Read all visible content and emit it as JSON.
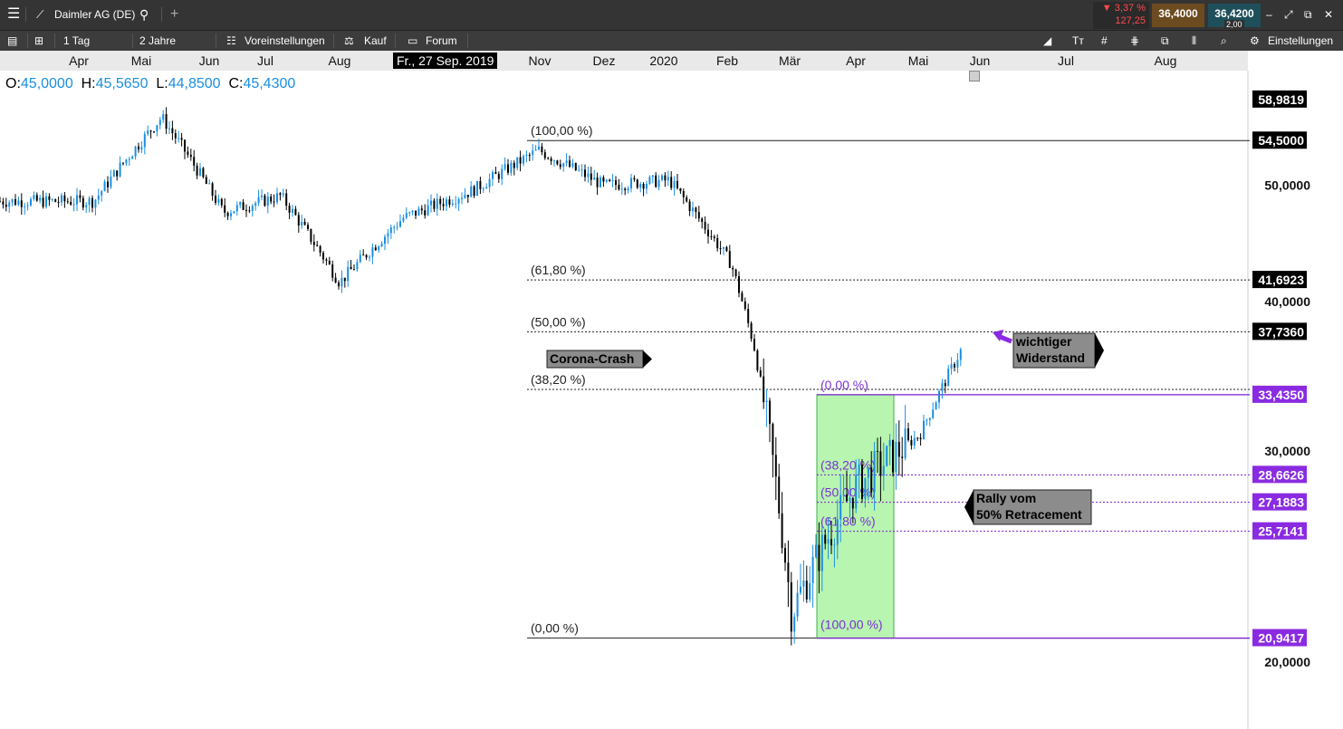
{
  "header": {
    "instrument": "Daimler AG (DE)",
    "change_pct": "▼ 3,37 %",
    "change_abs": "127,25",
    "bid": "36,4000",
    "ask": "36,4200",
    "spread": "2,00"
  },
  "toolbar": {
    "interval": "1 Tag",
    "range": "2 Jahre",
    "presets": "Voreinstellungen",
    "buy": "Kauf",
    "forum": "Forum",
    "settings": "Einstellungen"
  },
  "time_axis": {
    "labels": [
      "Apr",
      "Mai",
      "Jun",
      "Jul",
      "Aug",
      "Nov",
      "Dez",
      "2020",
      "Feb",
      "Mär",
      "Apr",
      "Mai",
      "Jun",
      "Jul",
      "Aug"
    ],
    "crosshair_date": "Fr., 27 Sep. 2019"
  },
  "ohlc": {
    "o_label": "O:",
    "o": "45,0000",
    "h_label": "H:",
    "h": "45,5650",
    "l_label": "L:",
    "l": "44,8500",
    "c_label": "C:",
    "c": "45,4300"
  },
  "chart_data": {
    "type": "candlestick",
    "x_label": "",
    "y_label": "",
    "y_ticks": [
      20,
      30,
      40,
      50
    ],
    "y_tick_labels": [
      "20,0000",
      "30,0000",
      "40,0000",
      "50,0000"
    ],
    "price_flags": [
      {
        "label": "58,9819",
        "color": "#000000"
      },
      {
        "label": "54,5000",
        "color": "#000000"
      },
      {
        "label": "41,6923",
        "color": "#000000"
      },
      {
        "label": "37,7360",
        "color": "#000000"
      },
      {
        "label": "33,4350",
        "color": "#8a2be2"
      },
      {
        "label": "28,6626",
        "color": "#8a2be2"
      },
      {
        "label": "27,1883",
        "color": "#8a2be2"
      },
      {
        "label": "25,7141",
        "color": "#8a2be2"
      },
      {
        "label": "20,9417",
        "color": "#8a2be2"
      }
    ],
    "fib_main": [
      {
        "label": "(100,00 %)",
        "value": 54.5
      },
      {
        "label": "(61,80 %)",
        "value": 41.6923
      },
      {
        "label": "(50,00 %)",
        "value": 37.736
      },
      {
        "label": "(38,20 %)",
        "value": 33.7797
      },
      {
        "label": "(0,00 %)",
        "value": 20.9417
      }
    ],
    "fib_second": [
      {
        "label": "(0,00 %)",
        "value": 33.435
      },
      {
        "label": "(38,20 %)",
        "value": 28.6626
      },
      {
        "label": "(50,00 %)",
        "value": 27.1883
      },
      {
        "label": "(61,80 %)",
        "value": 25.7141
      },
      {
        "label": "(100,00 %)",
        "value": 20.9417
      }
    ],
    "price_path": [
      {
        "date": "2019-04",
        "price": 48.5
      },
      {
        "date": "2019-05",
        "price": 57.0
      },
      {
        "date": "2019-06",
        "price": 47.5
      },
      {
        "date": "2019-07",
        "price": 49.0
      },
      {
        "date": "2019-08",
        "price": 41.5
      },
      {
        "date": "2019-09",
        "price": 47.0
      },
      {
        "date": "2019-10",
        "price": 49.5
      },
      {
        "date": "2019-11",
        "price": 53.5
      },
      {
        "date": "2019-12",
        "price": 50.0
      },
      {
        "date": "2020-01",
        "price": 50.5
      },
      {
        "date": "2020-02",
        "price": 43.0
      },
      {
        "date": "2020-02-28",
        "price": 36.5
      },
      {
        "date": "2020-03-16",
        "price": 22.0
      },
      {
        "date": "2020-04",
        "price": 28.0
      },
      {
        "date": "2020-05",
        "price": 31.0
      },
      {
        "date": "2020-06-05",
        "price": 36.4
      }
    ],
    "annotations": [
      {
        "text": "Corona-Crash"
      },
      {
        "text": "wichtiger",
        "text2": "Widerstand"
      },
      {
        "text": "Rally vom",
        "text2": "50% Retracement"
      }
    ]
  }
}
